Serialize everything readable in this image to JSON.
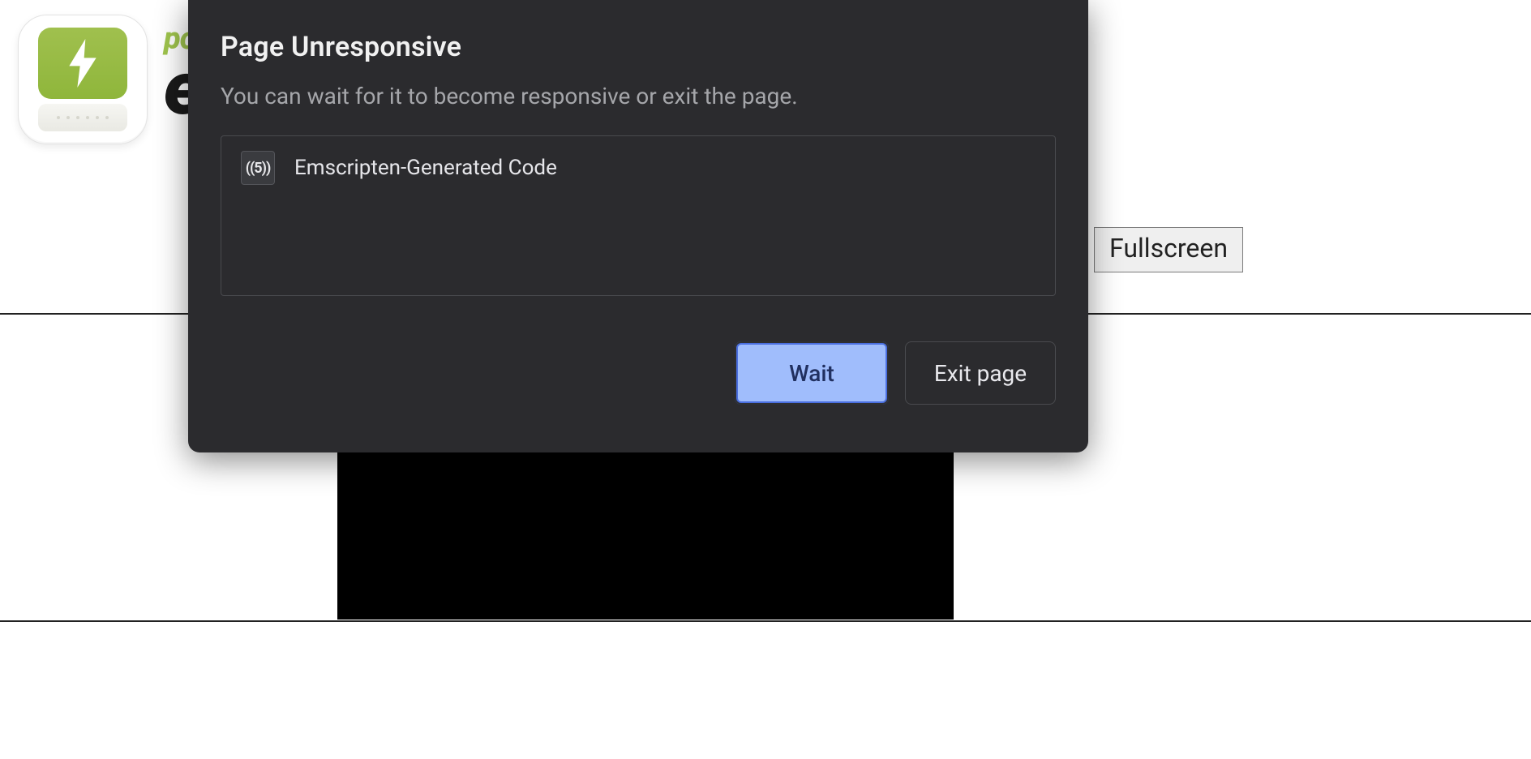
{
  "page": {
    "brand_small": "po",
    "brand_big": "e",
    "fullscreen_label": "Fullscreen"
  },
  "dialog": {
    "title": "Page Unresponsive",
    "subtitle": "You can wait for it to become responsive or exit the page.",
    "item": {
      "favicon_text": "((5))",
      "label": "Emscripten-Generated Code"
    },
    "wait_label": "Wait",
    "exit_label": "Exit page"
  }
}
